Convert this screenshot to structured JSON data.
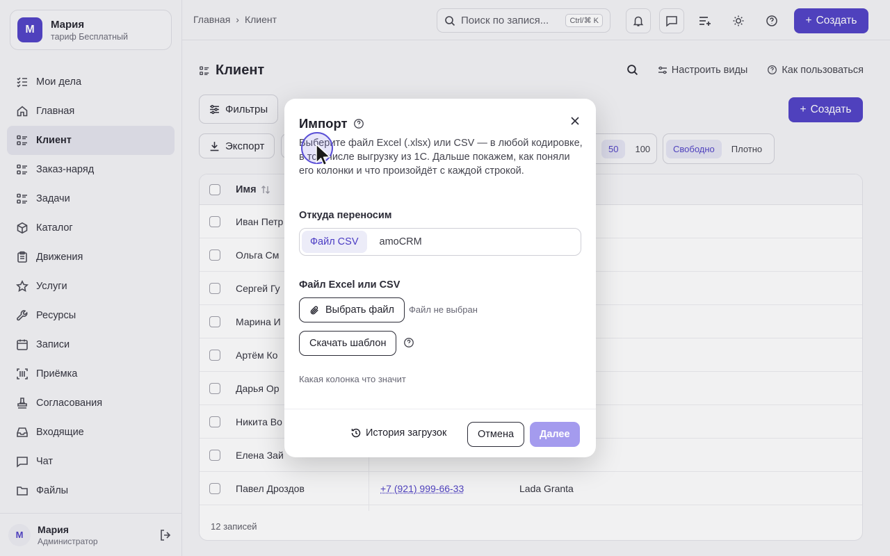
{
  "account": {
    "initial": "М",
    "name": "Мария",
    "plan": "тариф Бесплатный"
  },
  "nav": [
    {
      "label": "Мои дела",
      "icon": "checklist-icon"
    },
    {
      "label": "Главная",
      "icon": "home-icon"
    },
    {
      "label": "Клиент",
      "icon": "list-icon",
      "active": true
    },
    {
      "label": "Заказ-наряд",
      "icon": "list-icon"
    },
    {
      "label": "Задачи",
      "icon": "list-icon"
    },
    {
      "label": "Каталог",
      "icon": "box-icon"
    },
    {
      "label": "Движения",
      "icon": "clipboard-icon"
    },
    {
      "label": "Услуги",
      "icon": "star-icon"
    },
    {
      "label": "Ресурсы",
      "icon": "wrench-icon"
    },
    {
      "label": "Записи",
      "icon": "calendar-icon"
    },
    {
      "label": "Приёмка",
      "icon": "scan-icon"
    },
    {
      "label": "Согласования",
      "icon": "stamp-icon"
    },
    {
      "label": "Входящие",
      "icon": "inbox-icon"
    },
    {
      "label": "Чат",
      "icon": "chat-icon"
    },
    {
      "label": "Файлы",
      "icon": "folder-icon"
    }
  ],
  "user": {
    "initial": "М",
    "name": "Мария",
    "role": "Администратор"
  },
  "topbar": {
    "crumb_home": "Главная",
    "crumb_sep": "›",
    "crumb_current": "Клиент",
    "search_placeholder": "Поиск по запися...",
    "shortcut": "Ctrl/⌘ K",
    "create": "Создать"
  },
  "page": {
    "title": "Клиент",
    "configure_views": "Настроить виды",
    "how_to_use": "Как пользоваться",
    "filters": "Фильтры",
    "export": "Экспорт",
    "create": "Создать",
    "page_size_options": [
      "50",
      "100"
    ],
    "page_size_selected": "50",
    "density_options": [
      "Свободно",
      "Плотно"
    ],
    "density_selected": "Свободно",
    "col_name": "Имя",
    "footer": "12 записей"
  },
  "rows": [
    {
      "name": "Иван Петр",
      "phone": "",
      "car": ""
    },
    {
      "name": "Ольга См",
      "phone": "",
      "car": ""
    },
    {
      "name": "Сергей Гу",
      "phone": "",
      "car": ""
    },
    {
      "name": "Марина И",
      "phone": "",
      "car": ""
    },
    {
      "name": "Артём Ко",
      "phone": "",
      "car": ""
    },
    {
      "name": "Дарья Ор",
      "phone": "",
      "car": ""
    },
    {
      "name": "Никита Во",
      "phone": "",
      "car": ""
    },
    {
      "name": "Елена Зай",
      "phone": "",
      "car": ""
    },
    {
      "name": "Павел Дроздов",
      "phone": "+7 (921) 999-66-33",
      "car": "Lada Granta"
    }
  ],
  "modal": {
    "title": "Импорт",
    "description": "Выберите файл Excel (.xlsx) или CSV — в любой кодировке, в том числе выгрузку из 1С. Дальше покажем, как поняли его колонки и что произойдёт с каждой строкой.",
    "source_label": "Откуда переносим",
    "source_options": [
      "Файл CSV",
      "amoCRM"
    ],
    "source_selected": "Файл CSV",
    "file_label": "Файл Excel или CSV",
    "choose_file": "Выбрать файл",
    "no_file": "Файл не выбран",
    "download_template": "Скачать шаблон",
    "column_help": "Какая колонка что значит",
    "history": "История загрузок",
    "cancel": "Отмена",
    "next": "Далее"
  },
  "colors": {
    "accent": "#4b3cc4",
    "next_disabled": "#a49bee"
  }
}
